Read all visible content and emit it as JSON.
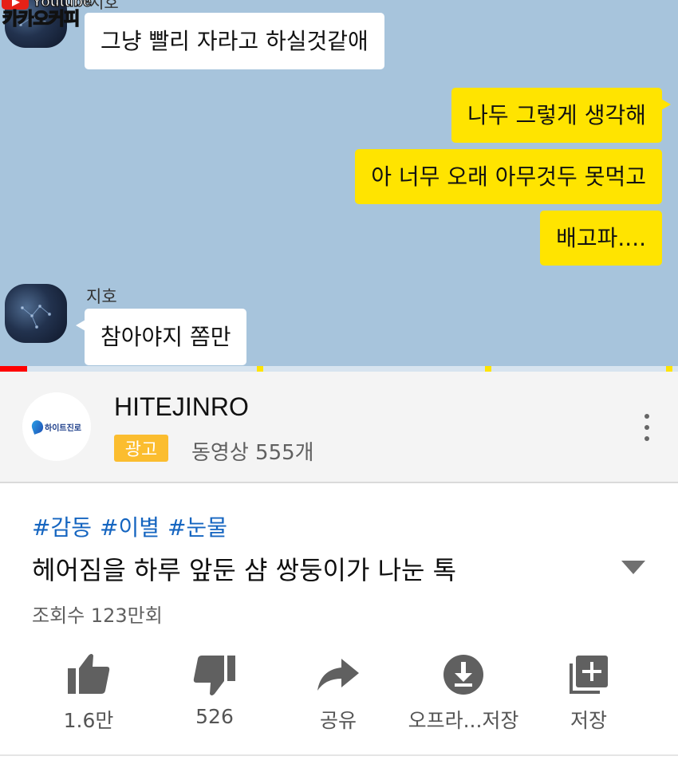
{
  "video": {
    "watermark": {
      "platform": "Youtube",
      "channel": "카카오커피",
      "sender_partial": "지호"
    },
    "messages": [
      {
        "side": "left",
        "text": "그냥 빨리 자라고 하실것같애"
      },
      {
        "side": "right",
        "text": "나두 그렇게 생각해"
      },
      {
        "side": "right",
        "text": "아 너무 오래 아무것두 못먹고"
      },
      {
        "side": "right",
        "text": "배고파...."
      },
      {
        "side": "left",
        "sender": "지호",
        "text": "참아야지 쫌만"
      }
    ],
    "progress_fraction": 0.04,
    "colors": {
      "chat_bg": "#a7c4dc",
      "my_bubble": "#ffe400",
      "their_bubble": "#ffffff",
      "progress": "#ff0000",
      "ad_marker": "#ffe400"
    }
  },
  "channel": {
    "avatar_text": "하이트진로",
    "name": "HITEJINRO",
    "ad_badge": "광고",
    "video_count": "동영상 555개",
    "menu_icon": "more-vert-icon",
    "ad_badge_color": "#fbbd2f"
  },
  "video_info": {
    "hashtags": [
      "#감동",
      "#이별",
      "#눈물"
    ],
    "title": "헤어짐을 하루 앞둔 샴 쌍둥이가 나눈 톡",
    "views": "조회수 123만회",
    "hashtag_color": "#1565c0"
  },
  "actions": [
    {
      "icon": "thumbs-up-icon",
      "label": "1.6만"
    },
    {
      "icon": "thumbs-down-icon",
      "label": "526"
    },
    {
      "icon": "share-icon",
      "label": "공유"
    },
    {
      "icon": "download-icon",
      "label": "오프라...저장"
    },
    {
      "icon": "add-to-playlist-icon",
      "label": "저장"
    }
  ]
}
